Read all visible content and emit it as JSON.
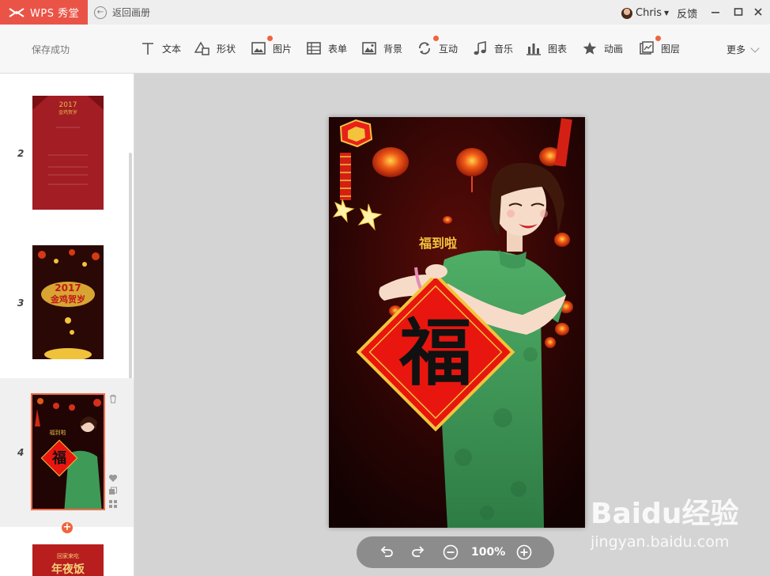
{
  "titlebar": {
    "app_name": "WPS 秀堂",
    "back_label": "返回画册",
    "user_name": "Chris",
    "feedback_label": "反馈"
  },
  "toolbar": {
    "save_status": "保存成功",
    "tools": [
      {
        "label": "文本",
        "icon": "text-icon",
        "dot": false
      },
      {
        "label": "形状",
        "icon": "shape-icon",
        "dot": false
      },
      {
        "label": "图片",
        "icon": "image-icon",
        "dot": true
      },
      {
        "label": "表单",
        "icon": "form-icon",
        "dot": false
      },
      {
        "label": "背景",
        "icon": "background-icon",
        "dot": false
      },
      {
        "label": "互动",
        "icon": "interaction-icon",
        "dot": true
      },
      {
        "label": "音乐",
        "icon": "music-icon",
        "dot": false
      },
      {
        "label": "图表",
        "icon": "chart-icon",
        "dot": false
      },
      {
        "label": "动画",
        "icon": "animation-icon",
        "dot": false
      },
      {
        "label": "图层",
        "icon": "layer-icon",
        "dot": true
      }
    ],
    "more_label": "更多"
  },
  "sidebar": {
    "slides": [
      {
        "number": "2",
        "thumb_text": "2017 金鸡贺岁"
      },
      {
        "number": "3",
        "thumb_text": "2017 金鸡贺岁"
      },
      {
        "number": "4",
        "thumb_text": "福到啦",
        "active": true
      },
      {
        "number": "",
        "thumb_text": "回家来吃 年夜饭"
      }
    ]
  },
  "poster": {
    "caption": "福到啦",
    "fu_char": "福"
  },
  "zoom": {
    "level": "100%"
  },
  "watermark": {
    "brand": "Baidu经验",
    "url": "jingyan.baidu.com"
  },
  "colors": {
    "brand_red": "#ea5447",
    "accent_orange": "#f0643c",
    "poster_red": "#e8160f",
    "dress_green": "#3e9a57"
  }
}
